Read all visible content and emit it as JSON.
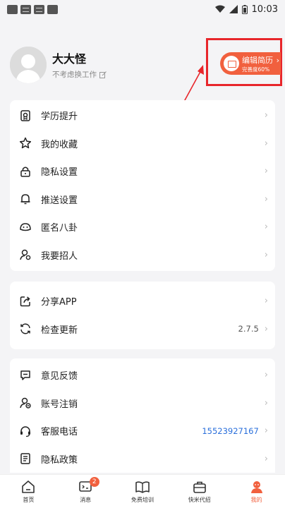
{
  "status_bar": {
    "time": "10:03"
  },
  "profile": {
    "name": "大大怪",
    "subtitle": "不考虑换工作"
  },
  "resume_button": {
    "title": "编辑简历",
    "completion": "完善度60%"
  },
  "section1": [
    {
      "label": "学历提升",
      "icon": "diploma-icon"
    },
    {
      "label": "我的收藏",
      "icon": "star-icon"
    },
    {
      "label": "隐私设置",
      "icon": "lock-icon"
    },
    {
      "label": "推送设置",
      "icon": "bell-icon"
    },
    {
      "label": "匿名八卦",
      "icon": "mask-icon"
    },
    {
      "label": "我要招人",
      "icon": "recruit-icon"
    }
  ],
  "section2": [
    {
      "label": "分享APP",
      "icon": "share-icon"
    },
    {
      "label": "检查更新",
      "icon": "refresh-icon",
      "value": "2.7.5"
    }
  ],
  "section3": [
    {
      "label": "意见反馈",
      "icon": "feedback-icon"
    },
    {
      "label": "账号注销",
      "icon": "account-cancel-icon"
    },
    {
      "label": "客服电话",
      "icon": "headset-icon",
      "value": "15523927167"
    },
    {
      "label": "隐私政策",
      "icon": "policy-icon"
    }
  ],
  "tabbar": [
    {
      "label": "首页",
      "icon": "home-icon"
    },
    {
      "label": "消息",
      "icon": "message-icon",
      "badge": "2"
    },
    {
      "label": "免费培训",
      "icon": "book-icon"
    },
    {
      "label": "快米代招",
      "icon": "briefcase-icon"
    },
    {
      "label": "我的",
      "icon": "profile-icon",
      "active": true
    }
  ],
  "colors": {
    "accent": "#f1603e",
    "highlight": "#e8262b",
    "phone": "#2a6fdb"
  }
}
